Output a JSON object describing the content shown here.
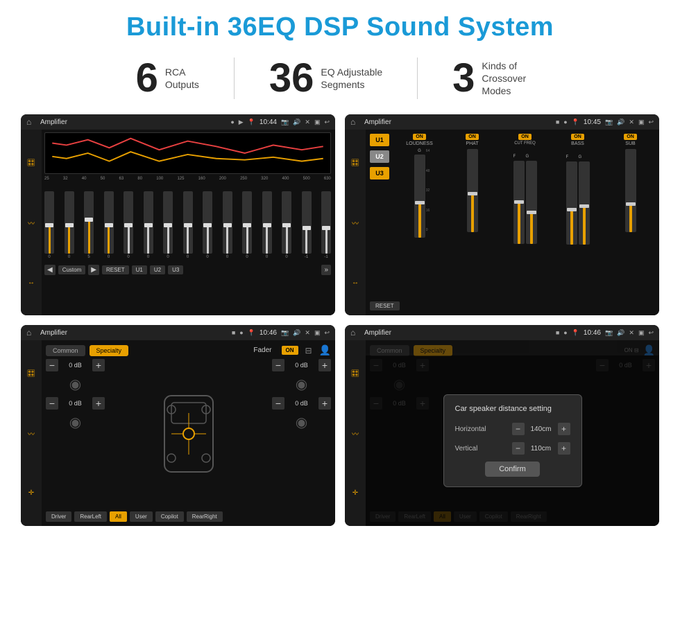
{
  "page": {
    "title": "Built-in 36EQ DSP Sound System"
  },
  "stats": {
    "rca": {
      "number": "6",
      "label": "RCA\nOutputs"
    },
    "eq": {
      "number": "36",
      "label": "EQ Adjustable\nSegments"
    },
    "crossover": {
      "number": "3",
      "label": "Kinds of\nCrossover Modes"
    }
  },
  "screens": {
    "eq": {
      "title": "Amplifier",
      "time": "10:44",
      "freq_labels": [
        "25",
        "32",
        "40",
        "50",
        "63",
        "80",
        "100",
        "125",
        "160",
        "200",
        "250",
        "320",
        "400",
        "500",
        "630"
      ],
      "bottom_buttons": [
        "Custom",
        "RESET",
        "U1",
        "U2",
        "U3"
      ]
    },
    "crossover": {
      "title": "Amplifier",
      "time": "10:45",
      "presets": [
        "U1",
        "U2",
        "U3"
      ],
      "channels": [
        "LOUDNESS",
        "PHAT",
        "CUT FREQ",
        "BASS",
        "SUB"
      ],
      "reset_label": "RESET"
    },
    "fader": {
      "title": "Amplifier",
      "time": "10:46",
      "tabs": [
        "Common",
        "Specialty"
      ],
      "fader_label": "Fader",
      "on_label": "ON",
      "volumes": [
        "0 dB",
        "0 dB",
        "0 dB",
        "0 dB"
      ],
      "bottom_presets": [
        "Driver",
        "RearLeft",
        "All",
        "User",
        "Copilot",
        "RearRight"
      ]
    },
    "distance": {
      "title": "Amplifier",
      "time": "10:46",
      "tabs": [
        "Common",
        "Specialty"
      ],
      "on_label": "ON",
      "dialog": {
        "title": "Car speaker distance setting",
        "horizontal_label": "Horizontal",
        "horizontal_value": "140cm",
        "vertical_label": "Vertical",
        "vertical_value": "110cm",
        "confirm_label": "Confirm"
      },
      "volumes": [
        "0 dB",
        "0 dB"
      ],
      "bottom_presets": [
        "Driver",
        "RearLeft",
        "All",
        "User",
        "Copilot",
        "RearRight"
      ]
    }
  }
}
